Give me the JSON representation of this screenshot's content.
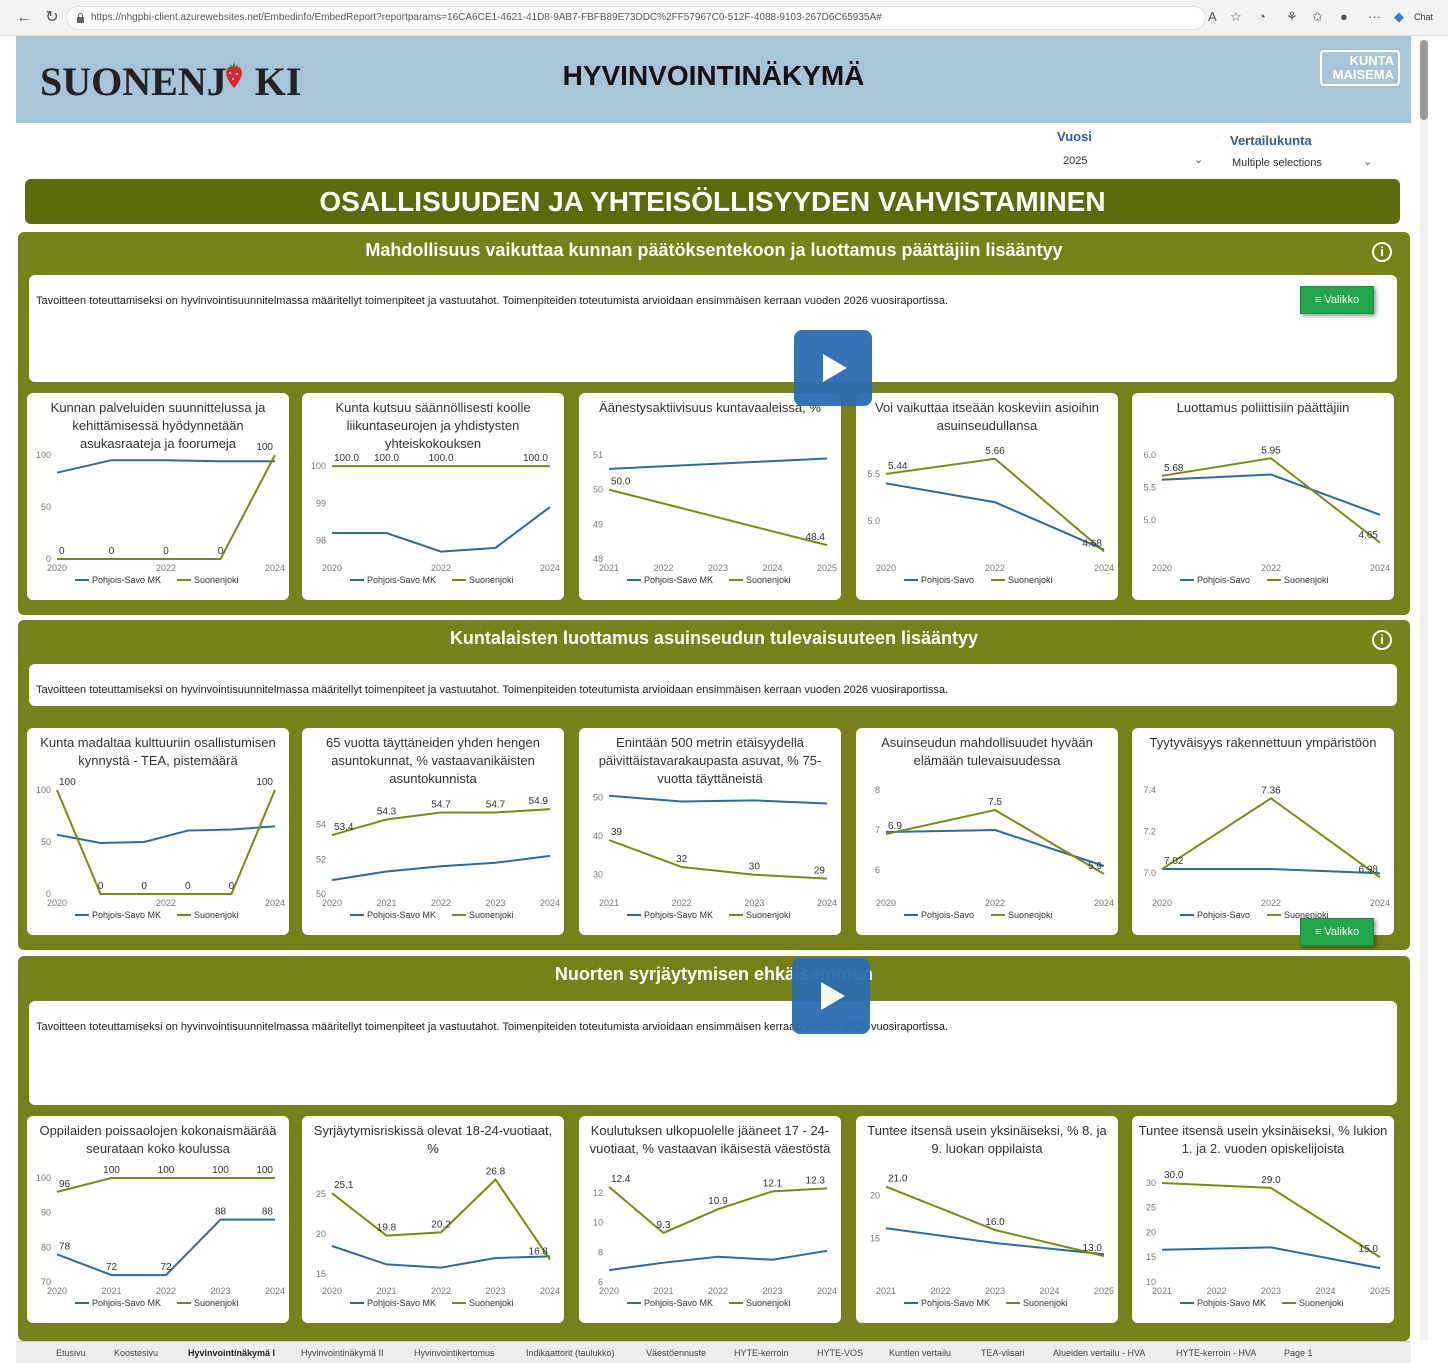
{
  "browser": {
    "url": "https://nhgpbi-client.azurewebsites.net/Embedinfo/EmbedReport?reportparams=16CA6CE1-4621-41D8-9AB7-FBFB89E73DDC%2FF57967C0-512F-4088-9103-267D6C65935A#",
    "chat_label": "Chat"
  },
  "header": {
    "logo_text": "Suonenjoki",
    "title": "HYVINVOINTINÄKYMÄ",
    "partner_logo": "KUNTA MAISEMA"
  },
  "slicers": {
    "year_label": "Vuosi",
    "year_value": "2025",
    "compare_label": "Vertailukunta",
    "compare_value": "Multiple selections"
  },
  "main_title": "OSALLISUUDEN JA YHTEISÖLLISYYDEN VAHVISTAMINEN",
  "valikko_label": "≡ Valikko",
  "colors": {
    "series1": "#2e6a9e",
    "series2": "#7a8a12"
  },
  "sections": [
    {
      "title": "Mahdollisuus vaikuttaa kunnan päätöksentekoon ja luottamus päättäjiin lisääntyy",
      "description": "Tavoitteen toteuttamiseksi on hyvinvointisuunnitelmassa määritellyt toimenpiteet ja vastuutahot. Toimenpiteiden toteutumista arvioidaan ensimmäisen kerraan vuoden 2026 vuosiraportissa."
    },
    {
      "title": "Kuntalaisten luottamus asuinseudun tulevaisuuteen lisääntyy",
      "description": "Tavoitteen toteuttamiseksi on hyvinvointisuunnitelmassa määritellyt toimenpiteet ja vastuutahot. Toimenpiteiden toteutumista arvioidaan ensimmäisen kerraan vuoden 2026 vuosiraportissa."
    },
    {
      "title": "Nuorten syrjäytymisen ehkäiseminen",
      "description": "Tavoitteen toteuttamiseksi on hyvinvointisuunnitelmassa määritellyt toimenpiteet ja vastuutahot. Toimenpiteiden toteutumista arvioidaan ensimmäisen kerraan vuoden 2026 vuosiraportissa."
    }
  ],
  "tabs": [
    "Etusivu",
    "Koostesivu",
    "Hyvinvointinäkymä I",
    "Hyvinvointinäkymä II",
    "Hyvinvointikertomus",
    "Indikaattorit (taulukko)",
    "Väestöennuste",
    "HYTE-kerroin",
    "HYTE-VOS",
    "Kuntien vertailu",
    "TEA-viisari",
    "Alueiden vertailu - HVA",
    "HYTE-kerroin - HVA",
    "Page 1"
  ],
  "chart_data": [
    {
      "type": "line",
      "title": "Kunnan palveluiden suunnittelussa ja kehittämisessä hyödynnetään asukasraateja ja foorumeja",
      "x": [
        2020,
        2021,
        2022,
        2023,
        2024
      ],
      "ylim": [
        0,
        100
      ],
      "yticks": [
        "0",
        "50",
        "100"
      ],
      "xticks": [
        "2020",
        "2022",
        "2024"
      ],
      "series": [
        {
          "name": "Pohjois-Savo MK",
          "values": [
            83,
            95,
            95,
            94,
            94
          ]
        },
        {
          "name": "Suonenjoki",
          "values": [
            0,
            0,
            0,
            0,
            100
          ],
          "labels": [
            "0",
            "0",
            "0",
            "0",
            "100"
          ]
        }
      ]
    },
    {
      "type": "line",
      "title": "Kunta kutsuu säännöllisesti koolle liikuntaseurojen ja yhdistysten yhteiskokouksen",
      "x": [
        2020,
        2021,
        2022,
        2023,
        2024
      ],
      "ylim": [
        97.5,
        100.3
      ],
      "yticks": [
        "98",
        "99",
        "100"
      ],
      "xticks": [
        "2020",
        "2022",
        "2024"
      ],
      "series": [
        {
          "name": "Pohjois-Savo MK",
          "values": [
            98.2,
            98.2,
            97.7,
            97.8,
            98.9
          ]
        },
        {
          "name": "Suonenjoki",
          "values": [
            100,
            100,
            100,
            100,
            100
          ],
          "labels": [
            "100.0",
            "100.0",
            "100.0",
            "",
            "100.0"
          ]
        }
      ]
    },
    {
      "type": "line",
      "title": "Äänestysaktiivisuus kuntavaaleissa, %",
      "x": [
        2021,
        2025
      ],
      "ylim": [
        48,
        51
      ],
      "yticks": [
        "48",
        "49",
        "50",
        "51"
      ],
      "xticks": [
        "2021",
        "2022",
        "2023",
        "2024",
        "2025"
      ],
      "series": [
        {
          "name": "Pohjois-Savo MK",
          "values": [
            50.6,
            50.9
          ]
        },
        {
          "name": "Suonenjoki",
          "values": [
            50.0,
            48.4
          ],
          "labels": [
            "50.0",
            "48.4"
          ]
        }
      ]
    },
    {
      "type": "line",
      "title": "Voi vaikuttaa itseään koskeviin asioihin asuinseudullansa",
      "x": [
        2020,
        2022,
        2024
      ],
      "ylim": [
        4.6,
        5.7
      ],
      "yticks": [
        "5.0",
        "5.5"
      ],
      "xticks": [
        "2020",
        "2022",
        "2024"
      ],
      "series": [
        {
          "name": "Pohjois-Savo",
          "values": [
            5.4,
            5.2,
            4.7
          ]
        },
        {
          "name": "Suonenjoki",
          "values": [
            5.5,
            5.66,
            4.68
          ],
          "labels": [
            "5.44",
            "5.66",
            "4.68"
          ]
        }
      ]
    },
    {
      "type": "line",
      "title": "Luottamus poliittisiin päättäjiin",
      "x": [
        2020,
        2022,
        2024
      ],
      "ylim": [
        4.4,
        6.0
      ],
      "yticks": [
        "5.0",
        "5.5",
        "6.0"
      ],
      "xticks": [
        "2020",
        "2022",
        "2024"
      ],
      "series": [
        {
          "name": "Pohjois-Savo",
          "values": [
            5.62,
            5.7,
            5.08
          ]
        },
        {
          "name": "Suonenjoki",
          "values": [
            5.68,
            5.95,
            4.65
          ],
          "labels": [
            "5.68",
            "5.95",
            "4.65"
          ]
        }
      ]
    },
    {
      "type": "line",
      "title": "Kunta madaltaa kulttuuriin osallistumisen kynnystä - TEA, pistemäärä",
      "x": [
        2020,
        2021,
        2022,
        2023,
        2024
      ],
      "ylim": [
        0,
        100
      ],
      "yticks": [
        "0",
        "50",
        "100"
      ],
      "xticks": [
        "2020",
        "2022",
        "2024"
      ],
      "series": [
        {
          "name": "Pohjois-Savo MK",
          "values": [
            57,
            49,
            50,
            61,
            62,
            65
          ]
        },
        {
          "name": "Suonenjoki",
          "values": [
            100,
            0,
            0,
            0,
            0,
            100
          ],
          "labels": [
            "100",
            "0",
            "0",
            "0",
            "0",
            "100"
          ]
        }
      ]
    },
    {
      "type": "line",
      "title": "65 vuotta täyttäneiden yhden hengen asuntokunnat, % vastaavanikäisten asuntokunnista",
      "x": [
        2020,
        2021,
        2022,
        2023,
        2024
      ],
      "ylim": [
        50,
        56
      ],
      "yticks": [
        "50",
        "52",
        "54"
      ],
      "xticks": [
        "2020",
        "2021",
        "2022",
        "2023",
        "2024"
      ],
      "series": [
        {
          "name": "Pohjois-Savo MK",
          "values": [
            50.8,
            51.3,
            51.6,
            51.8,
            52.2
          ]
        },
        {
          "name": "Suonenjoki",
          "values": [
            53.4,
            54.3,
            54.7,
            54.7,
            54.9
          ],
          "labels": [
            "53.4",
            "54.3",
            "54.7",
            "54.7",
            "54.9"
          ]
        }
      ]
    },
    {
      "type": "line",
      "title": "Enintään 500 metrin etäisyydellä päivittäistavarakaupasta asuvat, % 75-vuotta täyttäneistä",
      "x": [
        2021,
        2022,
        2023,
        2024
      ],
      "ylim": [
        25,
        52
      ],
      "yticks": [
        "30",
        "40",
        "50"
      ],
      "xticks": [
        "2021",
        "2022",
        "2023",
        "2024"
      ],
      "series": [
        {
          "name": "Pohjois-Savo MK",
          "values": [
            50.5,
            49,
            49.3,
            48.5
          ]
        },
        {
          "name": "Suonenjoki",
          "values": [
            39,
            32,
            30,
            29
          ],
          "labels": [
            "39",
            "32",
            "30",
            "29"
          ]
        }
      ]
    },
    {
      "type": "line",
      "title": "Asuinseudun mahdollisuudet hyvään elämään tulevaisuudessa",
      "x": [
        2020,
        2022,
        2024
      ],
      "ylim": [
        5.4,
        8.0
      ],
      "yticks": [
        "6",
        "7",
        "8"
      ],
      "xticks": [
        "2020",
        "2022",
        "2024"
      ],
      "series": [
        {
          "name": "Pohjois-Savo",
          "values": [
            6.95,
            7.0,
            6.1
          ]
        },
        {
          "name": "Suonenjoki",
          "values": [
            6.9,
            7.5,
            5.9
          ],
          "labels": [
            "6.9",
            "7.5",
            "5.9"
          ]
        }
      ]
    },
    {
      "type": "line",
      "title": "Tyytyväisyys rakennettuun ympäristöön",
      "x": [
        2020,
        2022,
        2024
      ],
      "ylim": [
        6.9,
        7.4
      ],
      "yticks": [
        "7.0",
        "7.2",
        "7.4"
      ],
      "xticks": [
        "2020",
        "2022",
        "2024"
      ],
      "series": [
        {
          "name": "Pohjois-Savo",
          "values": [
            7.02,
            7.02,
            7.0
          ]
        },
        {
          "name": "Suonenjoki",
          "values": [
            7.02,
            7.36,
            6.98
          ],
          "labels": [
            "7.02",
            "7.36",
            "6.98"
          ]
        }
      ]
    },
    {
      "type": "line",
      "title": "Oppilaiden poissaolojen kokonaismäärää seurataan koko koulussa",
      "x": [
        2020,
        2021,
        2022,
        2023,
        2024
      ],
      "ylim": [
        70,
        100
      ],
      "yticks": [
        "70",
        "80",
        "90",
        "100"
      ],
      "xticks": [
        "2020",
        "2021",
        "2022",
        "2023",
        "2024"
      ],
      "series": [
        {
          "name": "Pohjois-Savo MK",
          "values": [
            78,
            72,
            72,
            88,
            88
          ]
        },
        {
          "name": "Suonenjoki",
          "values": [
            96,
            100,
            100,
            100,
            100
          ],
          "labels": [
            "96",
            "100",
            "100",
            "100",
            "100"
          ]
        }
      ],
      "extra_labels": [
        "78",
        "72",
        "72",
        "88",
        "88"
      ]
    },
    {
      "type": "line",
      "title": "Syrjäytymisriskissä olevat 18-24-vuotiaat, %",
      "x": [
        2020,
        2021,
        2022,
        2023,
        2024
      ],
      "ylim": [
        14,
        27
      ],
      "yticks": [
        "15",
        "20",
        "25"
      ],
      "xticks": [
        "2020",
        "2021",
        "2022",
        "2023",
        "2024"
      ],
      "series": [
        {
          "name": "Pohjois-Savo MK",
          "values": [
            18.5,
            16.2,
            15.8,
            17,
            17.2
          ]
        },
        {
          "name": "Suonenjoki",
          "values": [
            25.1,
            19.8,
            20.2,
            26.8,
            16.8
          ],
          "labels": [
            "25.1",
            "19.8",
            "20.2",
            "26.8",
            "16.8"
          ]
        }
      ]
    },
    {
      "type": "line",
      "title": "Koulutuksen ulkopuolelle jääneet 17 - 24-vuotiaat, % vastaavan ikäisestä väestöstä",
      "x": [
        2020,
        2021,
        2022,
        2023,
        2024
      ],
      "ylim": [
        6,
        13
      ],
      "yticks": [
        "6",
        "8",
        "10",
        "12"
      ],
      "xticks": [
        "2020",
        "2021",
        "2022",
        "2023",
        "2024"
      ],
      "series": [
        {
          "name": "Pohjois-Savo MK",
          "values": [
            6.8,
            7.3,
            7.7,
            7.5,
            8.1
          ]
        },
        {
          "name": "Suonenjoki",
          "values": [
            12.4,
            9.3,
            10.9,
            12.1,
            12.3
          ],
          "labels": [
            "12.4",
            "9.3",
            "10.9",
            "12.1",
            "12.3"
          ]
        }
      ]
    },
    {
      "type": "line",
      "title": "Tuntee itsensä usein yksinäiseksi, % 8. ja 9. luokan oppilaista",
      "x": [
        2021,
        2023,
        2025
      ],
      "ylim": [
        10,
        22
      ],
      "yticks": [
        "15",
        "20"
      ],
      "xticks": [
        "2021",
        "2022",
        "2023",
        "2024",
        "2025"
      ],
      "series": [
        {
          "name": "Pohjois-Savo MK",
          "values": [
            16.2,
            14.5,
            13.2
          ]
        },
        {
          "name": "Suonenjoki",
          "values": [
            21.0,
            16.0,
            13.0
          ],
          "labels": [
            "21.0",
            "16.0",
            "13.0"
          ]
        }
      ]
    },
    {
      "type": "line",
      "title": "Tuntee itsensä usein yksinäiseksi, % lukion 1. ja 2. vuoden opiskelijoista",
      "x": [
        2021,
        2023,
        2025
      ],
      "ylim": [
        10,
        31
      ],
      "yticks": [
        "10",
        "15",
        "20",
        "25",
        "30"
      ],
      "xticks": [
        "2021",
        "2022",
        "2023",
        "2024",
        "2025"
      ],
      "series": [
        {
          "name": "Pohjois-Savo MK",
          "values": [
            16.5,
            17,
            12.8
          ]
        },
        {
          "name": "Suonenjoki",
          "values": [
            30.0,
            29.0,
            15.0
          ],
          "labels": [
            "30.0",
            "29.0",
            "15.0"
          ]
        }
      ]
    }
  ]
}
